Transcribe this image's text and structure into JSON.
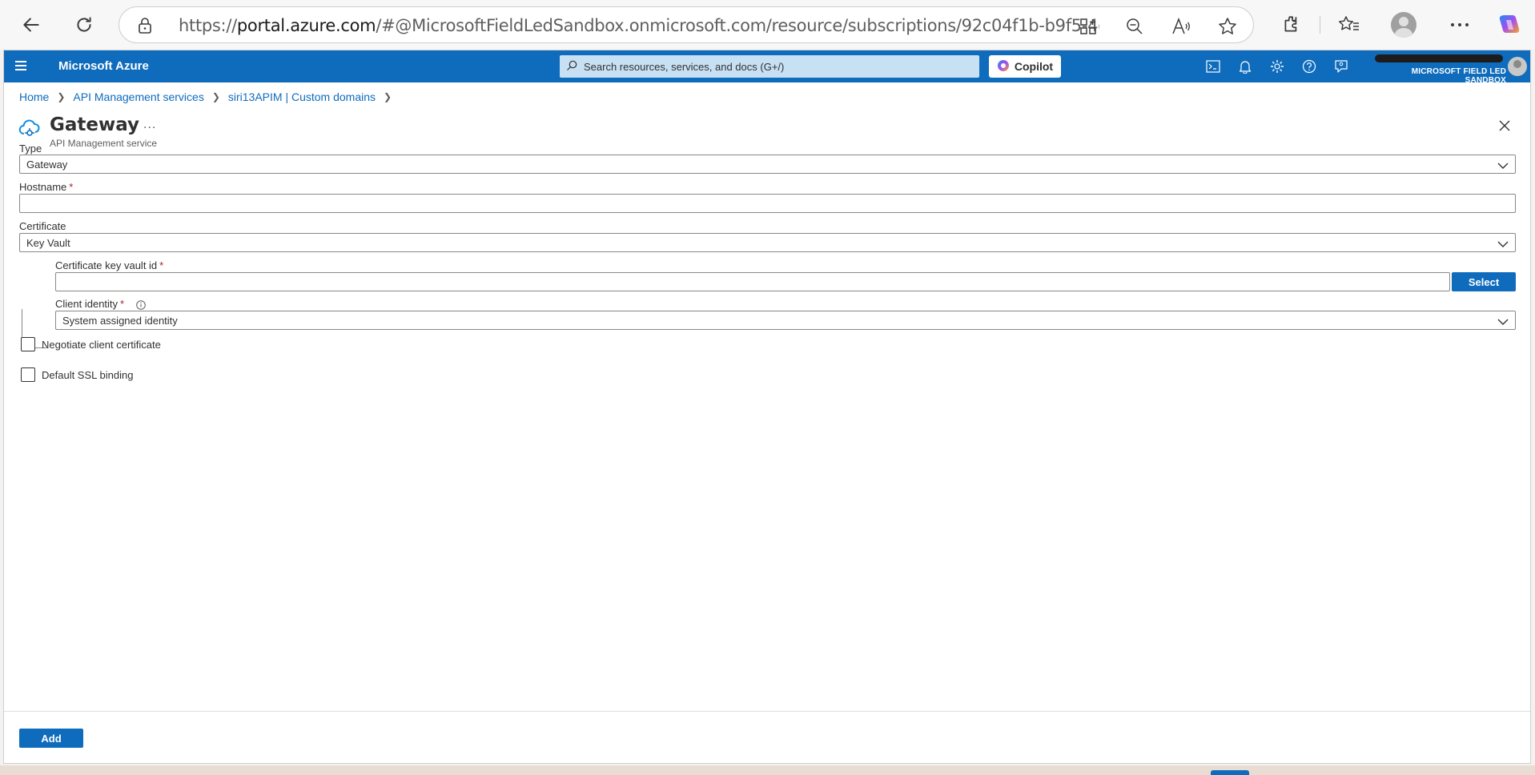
{
  "browser": {
    "url_prefix": "https://",
    "url_host": "portal.azure.com",
    "url_rest": "/#@MicrosoftFieldLedSandbox.onmicrosoft.com/resource/subscriptions/92c04f1b-b9f5-4dc..."
  },
  "topbar": {
    "brand": "Microsoft Azure",
    "search_placeholder": "Search resources, services, and docs (G+/)",
    "copilot_label": "Copilot",
    "directory": "MICROSOFT FIELD LED SANDBOX"
  },
  "breadcrumb": {
    "items": [
      "Home",
      "API Management services",
      "siri13APIM | Custom domains"
    ]
  },
  "header": {
    "title": "Gateway",
    "more": "...",
    "subtitle": "API Management service"
  },
  "form": {
    "type_label": "Type",
    "type_value": "Gateway",
    "hostname_label": "Hostname",
    "hostname_value": "",
    "required_mark": "*",
    "certificate_label": "Certificate",
    "certificate_value": "Key Vault",
    "kv_id_label": "Certificate key vault id",
    "kv_id_value": "",
    "select_label": "Select",
    "client_identity_label": "Client identity",
    "client_identity_value": "System assigned identity",
    "negotiate_label": "Negotiate client certificate",
    "negotiate_checked": false,
    "default_ssl_label": "Default SSL binding",
    "default_ssl_checked": false
  },
  "footer": {
    "add_label": "Add"
  },
  "colors": {
    "accent": "#0f6cbd",
    "required": "#a4262c"
  }
}
